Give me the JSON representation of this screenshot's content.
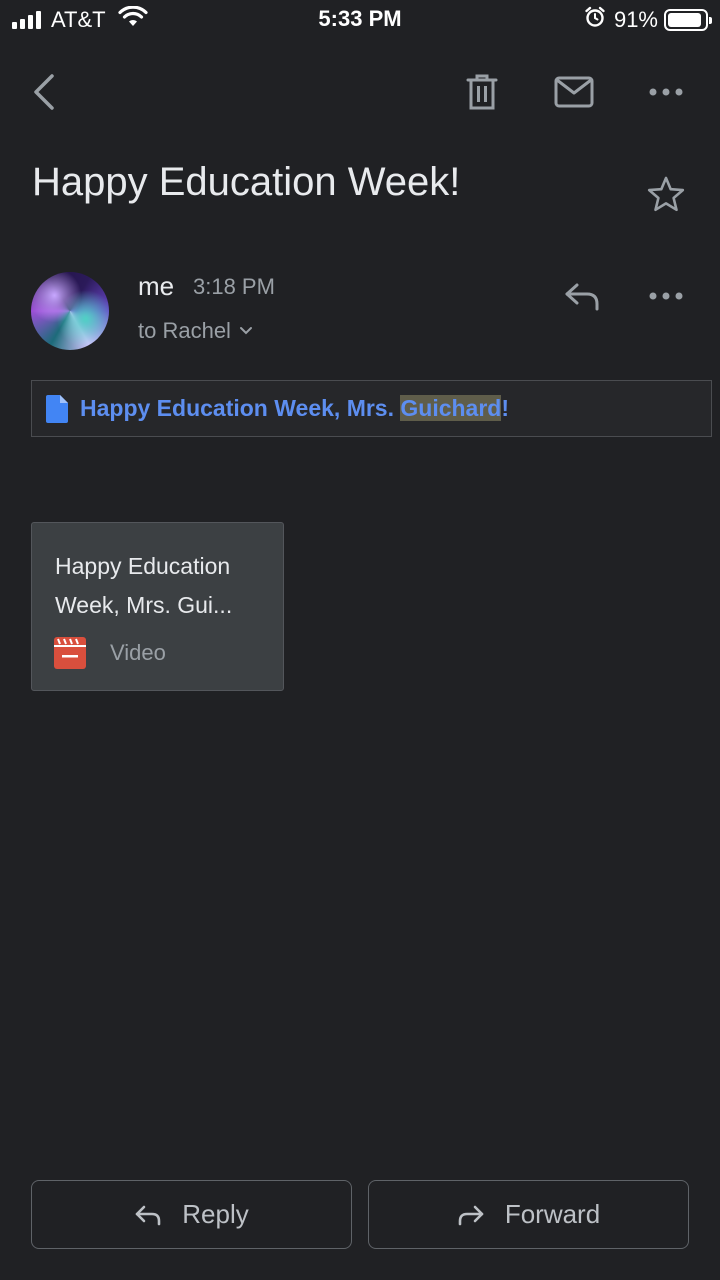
{
  "status_bar": {
    "carrier": "AT&T",
    "time": "5:33 PM",
    "battery_percent": "91%",
    "battery_level": 0.91
  },
  "toolbar": {
    "icons": [
      "back-arrow-icon",
      "trash-icon",
      "mail-icon",
      "more-horizontal-icon"
    ]
  },
  "email": {
    "subject": "Happy Education Week!",
    "sender": "me",
    "time": "3:18 PM",
    "recipient": "to Rachel",
    "doc_link": {
      "text_before": "Happy Education Week, Mrs. ",
      "text_highlight": "Guichard",
      "text_after": "!"
    },
    "attachment": {
      "title": "Happy Education Week, Mrs. Gui...",
      "type": "Video"
    }
  },
  "actions": {
    "reply_label": "Reply",
    "forward_label": "Forward"
  },
  "colors": {
    "background": "#202124",
    "link": "#5d8ef0",
    "video_icon": "#d94f3d",
    "doc_icon": "#4285f4"
  }
}
